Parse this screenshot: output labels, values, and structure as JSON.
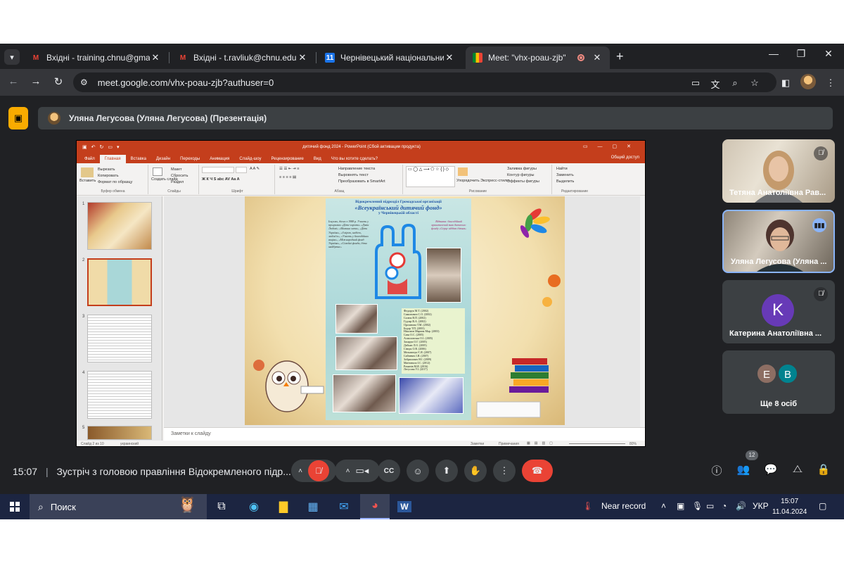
{
  "browser": {
    "tabs": [
      {
        "label": "Вхідні - training.chnu@gmail.com",
        "icon": "gmail-icon"
      },
      {
        "label": "Вхідні - t.ravliuk@chnu.edu.ua",
        "icon": "gmail-icon"
      },
      {
        "label": "Чернівецький національний у",
        "icon": "calendar-icon"
      },
      {
        "label": "Meet: \"vhx-poau-zjb\"",
        "icon": "meet-icon"
      }
    ],
    "url": "meet.google.com/vhx-poau-zjb?authuser=0"
  },
  "presentation": {
    "presenter": "Уляна Легусова (Уляна Легусова) (Презентація)"
  },
  "ppt": {
    "window_title": "дитячий фонд 2024 - PowerPoint (Сбой активации продукта)",
    "tabs": [
      "Файл",
      "Главная",
      "Вставка",
      "Дизайн",
      "Переходы",
      "Анимация",
      "Слайд-шоу",
      "Рецензирование",
      "Вид",
      "Что вы хотите сделать?"
    ],
    "share": "Общий доступ",
    "groups": [
      "Буфер обмена",
      "Слайды",
      "Шрифт",
      "Абзац",
      "Рисование",
      "Редактирование"
    ],
    "clipboard": [
      "Вырезать",
      "Копировать",
      "Формат по образцу",
      "Вставить"
    ],
    "slides_grp": [
      "Макет",
      "Сбросить",
      "Раздел",
      "Создать слайд"
    ],
    "paragraph": [
      "Направление текста",
      "Выровнять текст",
      "Преобразовать в SmartArt"
    ],
    "drawing": [
      "Упорядочить",
      "Экспресс-стили",
      "Заливка фигуры",
      "Контур фигуры",
      "Эффекты фигуры"
    ],
    "editing": [
      "Найти",
      "Заменить",
      "Выделить"
    ],
    "slide_numbers": [
      "1",
      "2",
      "3",
      "4",
      "5"
    ],
    "notes_placeholder": "Заметки к слайду",
    "status": "Слайд 2 из 10",
    "language": "украинский",
    "notes_btn": "Заметки",
    "comments_btn": "Примечания",
    "zoom": "80%",
    "poster": {
      "head1": "Відокремлений підрозділ Громадської організації",
      "head2": "«Всеукраїнський дитячий фонд»",
      "head3": "у Чернівецькій області",
      "left_text": "Існуємо, діємо з 1988 р. Участь у програмах «Діти-сироти» «Дзвін Любові» «Мамина хата», «Діти України», «З вірою, надією, любов'ю», «Участь у благодійних акціях», «Міжнародний фонд Україна», «Сімейні фонди, діти майбутнє»",
      "right_text": "Відзнака: благодійний кришталевий знак дитячого фонду «Серце віддаю дітям»",
      "list": [
        "Федорук М.Т. (2002)",
        "Симонович С.О. (2002)",
        "Салюк В.П. (2002)",
        "Гудзар В.А. (2002)",
        "Оргланова Т.М. (2002)",
        "Бодар Т.П. (2003)",
        "Ніколаєв Марина Мар. (2003)",
        "Сава О.С. (2005)",
        "Асмоловська О.І. (2005)",
        "Захарук О.Г. (2005)",
        "Дейсан Л.О. (2005)",
        "Сівчук О.В. (2006)",
        "Мельничук Є.Я. (2007)",
        "Сайчевич І.Я. (2007)",
        "Зобрилович Н.І. (2009)",
        "Мантавало І.С. (2012)",
        "Романів М.Я. (2016)",
        "Легусова У.І. (2017)"
      ]
    }
  },
  "participants": [
    {
      "name": "Тетяна Анатоліївна Рав...",
      "muted": true,
      "kind": "video"
    },
    {
      "name": "Уляна Легусова (Уляна ...",
      "muted": false,
      "kind": "video",
      "speaking": true
    },
    {
      "name": "Катерина Анатоліївна ...",
      "muted": true,
      "kind": "avatar",
      "initial": "K",
      "color": "#673ab7"
    },
    {
      "name": "Ще 8 осіб",
      "kind": "group",
      "initials": [
        "E",
        "B"
      ],
      "colors": [
        "#8d6e63",
        "#00838f"
      ]
    }
  ],
  "meeting": {
    "time": "15:07",
    "title": "Зустріч з головою правління Відокремленого підр...",
    "people_count": "12"
  },
  "taskbar": {
    "search": "Поиск",
    "weather": "Near record",
    "lang": "УКР",
    "time": "15:07",
    "date": "11.04.2024"
  },
  "colors": {
    "meet_dark": "#202124",
    "control": "#3c4043",
    "hangup": "#ea4335",
    "ppt_accent": "#c43e1c",
    "taskbar": "#1c2541"
  }
}
